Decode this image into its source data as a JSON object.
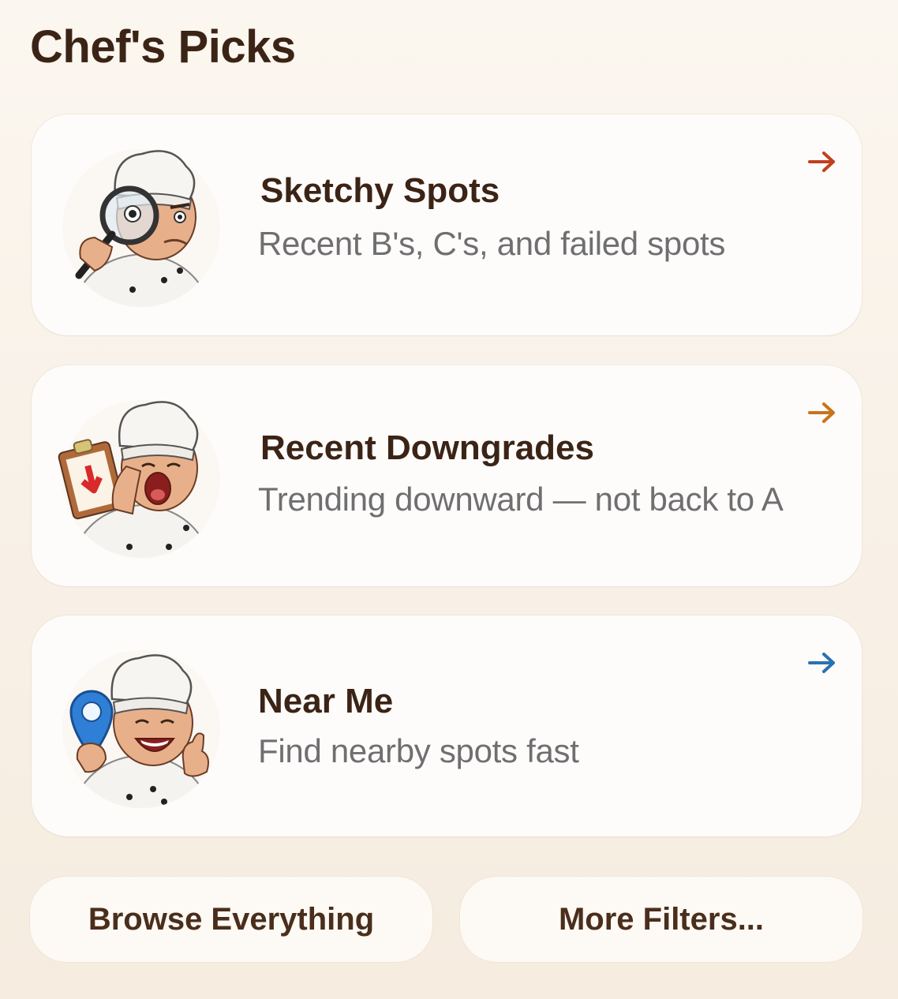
{
  "header": {
    "title": "Chef's Picks"
  },
  "cards": [
    {
      "title": "Sketchy Spots",
      "subtitle": "Recent B's, C's, and failed spots",
      "avatar": "chef-magnifying-glass",
      "arrow_color": "#c0401e"
    },
    {
      "title": "Recent Downgrades",
      "subtitle": "Trending downward — not back to A",
      "avatar": "chef-yawning-clipboard",
      "arrow_color": "#c8741a"
    },
    {
      "title": "Near Me",
      "subtitle": "Find nearby spots fast",
      "avatar": "chef-location-pin-thumbs-up",
      "arrow_color": "#2a72b0"
    }
  ],
  "buttons": {
    "browse_label": "Browse Everything",
    "more_label": "More Filters..."
  },
  "colors": {
    "background": "#f8f0e6",
    "card": "#fefcfa",
    "title_text": "#3b2416",
    "subtitle_text": "#6f6f72"
  }
}
